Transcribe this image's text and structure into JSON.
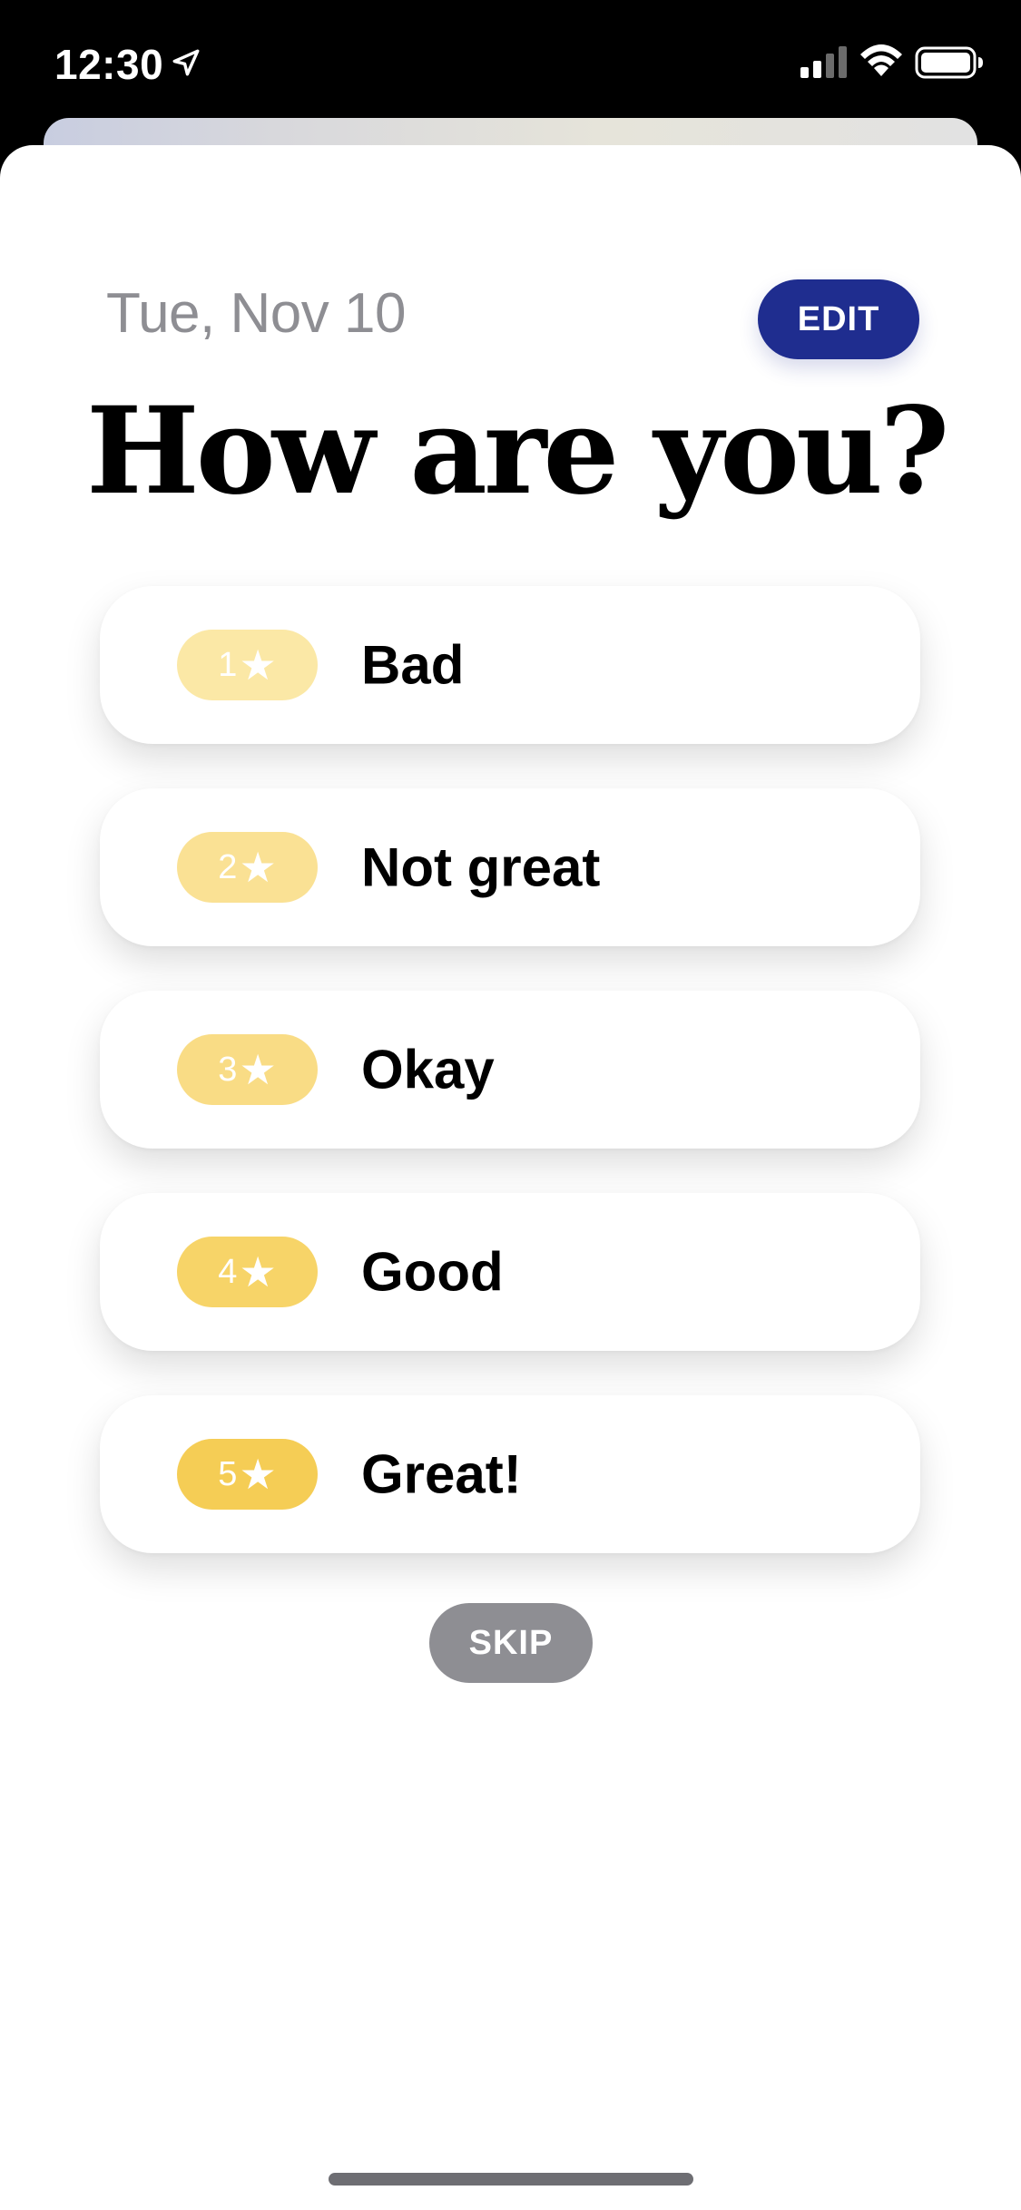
{
  "status_bar": {
    "time": "12:30",
    "icons": [
      "location-arrow-icon",
      "cellular-signal-icon",
      "wifi-icon",
      "battery-icon"
    ]
  },
  "header": {
    "date": "Tue, Nov 10",
    "edit_label": "EDIT",
    "title": "How are you?"
  },
  "ratings": [
    {
      "stars": "1",
      "label": "Bad",
      "badge_color": "#fbe8a6"
    },
    {
      "stars": "2",
      "label": "Not great",
      "badge_color": "#fae194"
    },
    {
      "stars": "3",
      "label": "Okay",
      "badge_color": "#f9dc85"
    },
    {
      "stars": "4",
      "label": "Good",
      "badge_color": "#f7d468"
    },
    {
      "stars": "5",
      "label": "Great!",
      "badge_color": "#f5cd55"
    }
  ],
  "skip_label": "SKIP",
  "colors": {
    "accent": "#1f2d8f",
    "secondary_text": "#8e8e93",
    "skip_button": "#8e8e93"
  }
}
